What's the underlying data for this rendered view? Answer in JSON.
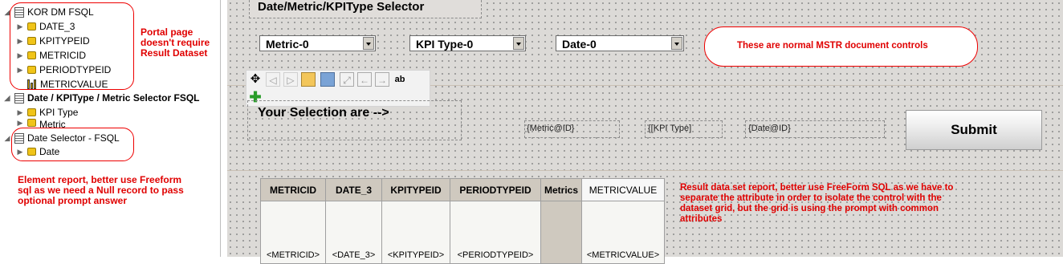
{
  "tree": {
    "report1": {
      "name": "KOR DM FSQL",
      "children": [
        "DATE_3",
        "KPITYPEID",
        "METRICID",
        "PERIODTYPEID"
      ],
      "metric": "METRICVALUE"
    },
    "report2": {
      "name": "Date / KPIType / Metric Selector FSQL",
      "children": [
        "KPI Type",
        "Metric"
      ]
    },
    "report3": {
      "name": "Date Selector - FSQL",
      "children": [
        "Date"
      ]
    }
  },
  "notes": {
    "portal": [
      "Portal page",
      "doesn't require",
      "Result Dataset"
    ],
    "element": [
      "Element report, better use Freeform",
      "sql as we need a Null record to pass",
      "optional prompt answer"
    ],
    "controls": "These are normal MSTR document controls",
    "result": [
      "Result data set report, better use FreeForm SQL as we have to",
      "separate the attribute in order to isolate the control with the",
      "dataset grid, but the grid is using the prompt with common",
      "attributes"
    ]
  },
  "canvas": {
    "section_title": "Date/Metric/KPIType Selector",
    "selectors": [
      "Metric-0",
      "KPI Type-0",
      "Date-0"
    ],
    "selection_label": "Your Selection are -->",
    "fields": [
      "{Metric@ID}",
      "{[KPI Type]",
      "{Date@ID}"
    ],
    "submit_label": "Submit"
  },
  "grid": {
    "headers": [
      "METRICID",
      "DATE_3",
      "KPITYPEID",
      "PERIODTYPEID",
      "Metrics",
      "METRICVALUE"
    ],
    "cells": [
      "<METRICID>",
      "<DATE_3>",
      "<KPITYPEID>",
      "<PERIODTYPEID>",
      "",
      "<METRICVALUE>"
    ]
  },
  "toolbar": {
    "icons": [
      "move-icon",
      "back-icon",
      "forward-icon",
      "insert-icon",
      "group-icon",
      "expand-icon",
      "left-arrow-icon",
      "right-arrow-icon",
      "spell-icon",
      "add-icon"
    ]
  },
  "colors": {
    "note_red": "#e00000",
    "canvas_bg": "#dcdad7",
    "header_bg": "#cfc9bf",
    "tree_cube": "#f0c419"
  }
}
